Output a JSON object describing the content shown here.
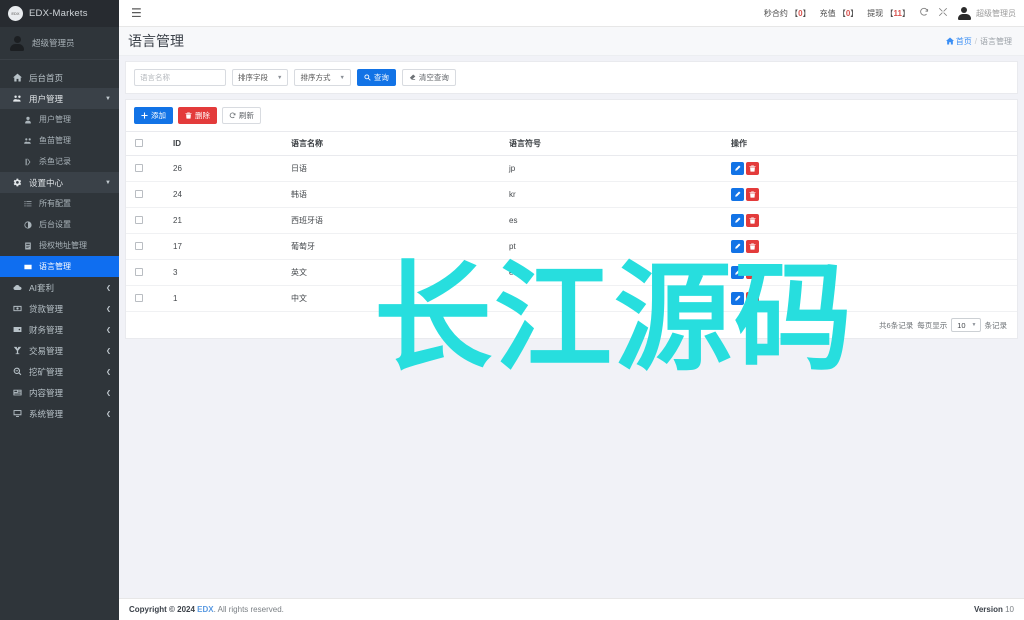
{
  "sidebar": {
    "brand": {
      "logo_text": "EDX",
      "title": "EDX-Markets"
    },
    "user": {
      "name": "超级管理员"
    },
    "items": [
      {
        "label": "后台首页",
        "icon": "home-icon",
        "level": "top",
        "state": "normal",
        "caret": ""
      },
      {
        "label": "用户管理",
        "icon": "users-icon",
        "level": "top",
        "state": "group",
        "caret": "▼"
      },
      {
        "label": "用户管理",
        "icon": "user-icon",
        "level": "child",
        "state": "normal",
        "caret": ""
      },
      {
        "label": "鱼苗管理",
        "icon": "users-icon",
        "level": "child",
        "state": "normal",
        "caret": ""
      },
      {
        "label": "杀鱼记录",
        "icon": "knife-icon",
        "level": "child",
        "state": "normal",
        "caret": ""
      },
      {
        "label": "设置中心",
        "icon": "gears-icon",
        "level": "top",
        "state": "group",
        "caret": "▼"
      },
      {
        "label": "所有配置",
        "icon": "list-icon",
        "level": "child",
        "state": "normal",
        "caret": ""
      },
      {
        "label": "后台设置",
        "icon": "contrast-icon",
        "level": "child",
        "state": "normal",
        "caret": ""
      },
      {
        "label": "授权地址管理",
        "icon": "book-icon",
        "level": "child",
        "state": "normal",
        "caret": ""
      },
      {
        "label": "语言管理",
        "icon": "language-icon",
        "level": "child",
        "state": "active",
        "caret": ""
      },
      {
        "label": "AI套利",
        "icon": "cloud-icon",
        "level": "top",
        "state": "normal",
        "caret": "❮"
      },
      {
        "label": "贷款管理",
        "icon": "money-icon",
        "level": "top",
        "state": "normal",
        "caret": "❮"
      },
      {
        "label": "财务管理",
        "icon": "wallet-icon",
        "level": "top",
        "state": "normal",
        "caret": "❮"
      },
      {
        "label": "交易管理",
        "icon": "chart-icon",
        "level": "top",
        "state": "normal",
        "caret": "❮"
      },
      {
        "label": "挖矿管理",
        "icon": "search-icon",
        "level": "top",
        "state": "normal",
        "caret": "❮"
      },
      {
        "label": "内容管理",
        "icon": "news-icon",
        "level": "top",
        "state": "normal",
        "caret": "❮"
      },
      {
        "label": "系统管理",
        "icon": "monitor-icon",
        "level": "top",
        "state": "normal",
        "caret": "❮"
      }
    ]
  },
  "topbar": {
    "menu_toggle": "☰",
    "stats": [
      {
        "label": "秒合约",
        "value": "0"
      },
      {
        "label": "充值",
        "value": "0"
      },
      {
        "label": "提现",
        "value": "11"
      }
    ],
    "refresh_icon": "refresh-icon",
    "fullscreen_icon": "fullscreen-icon",
    "username": "超级管理员"
  },
  "page": {
    "title": "语言管理",
    "breadcrumb": {
      "home": "首页",
      "separator": "/",
      "current": "语言管理"
    }
  },
  "filter": {
    "name_placeholder": "语言名称",
    "name_value": "",
    "sort_field_label": "排序字段",
    "sort_order_label": "排序方式",
    "search_button": "查询",
    "clear_button": "清空查询"
  },
  "toolbar": {
    "add_label": "添加",
    "delete_label": "删除",
    "refresh_label": "刷新"
  },
  "table": {
    "columns": [
      "",
      "ID",
      "语言名称",
      "语言符号",
      "操作"
    ],
    "rows": [
      {
        "id": "26",
        "name": "日语",
        "symbol": "jp"
      },
      {
        "id": "24",
        "name": "韩语",
        "symbol": "kr"
      },
      {
        "id": "21",
        "name": "西班牙语",
        "symbol": "es"
      },
      {
        "id": "17",
        "name": "葡萄牙",
        "symbol": "pt"
      },
      {
        "id": "3",
        "name": "英文",
        "symbol": "en"
      },
      {
        "id": "1",
        "name": "中文",
        "symbol": ""
      }
    ]
  },
  "pager": {
    "total_text": "共6条记录",
    "per_page_label": "每页显示",
    "per_page_value": "10",
    "suffix": "条记录"
  },
  "watermark": {
    "text": "长江源码"
  },
  "footer": {
    "copyright_prefix": "Copyright © 2024",
    "brand": "EDX",
    "copyright_suffix": ". All rights reserved.",
    "version_label": "Version",
    "version_value": "10"
  },
  "colors": {
    "sidebar_bg": "#2f353a",
    "accent_blue": "#1273e6",
    "danger_red": "#e33b3b",
    "watermark": "#27dede"
  }
}
